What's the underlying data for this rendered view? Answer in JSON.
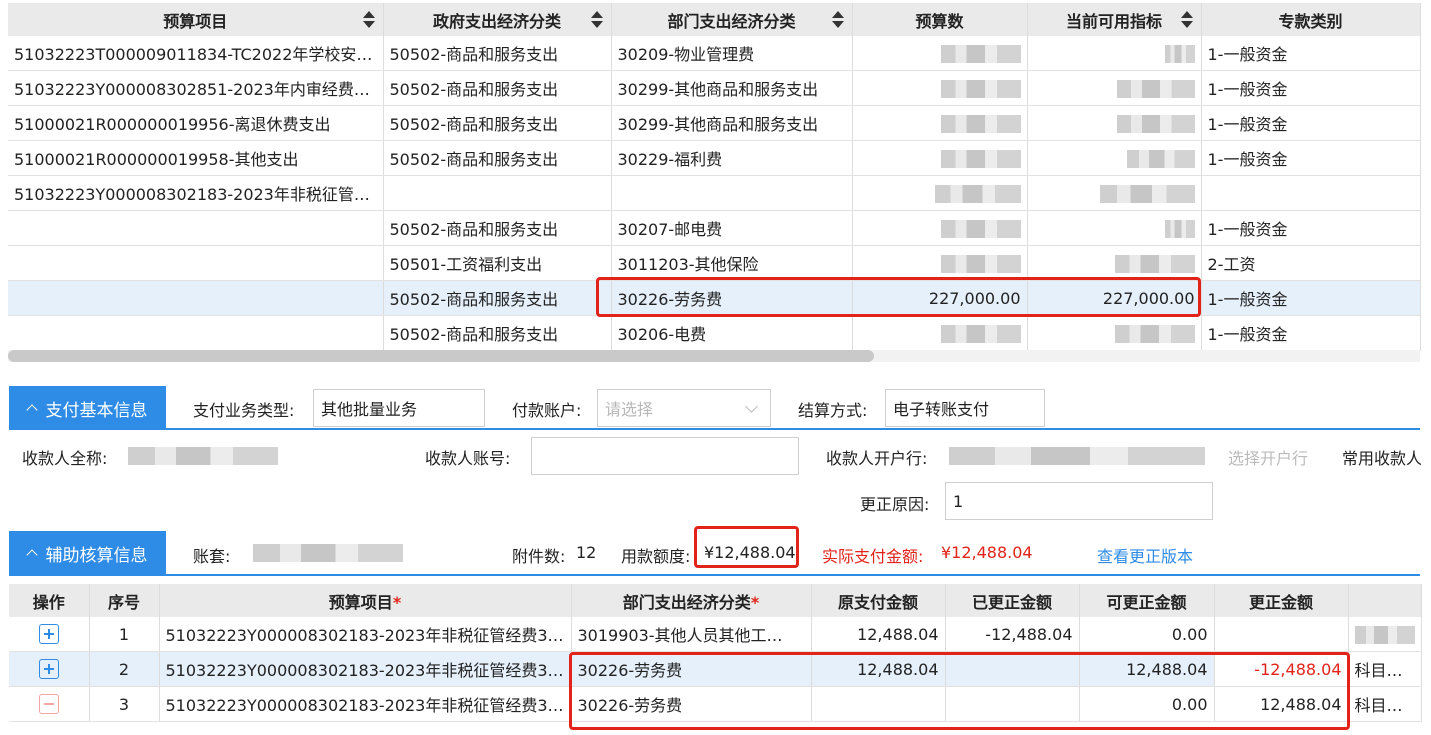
{
  "top_table": {
    "headers": [
      "预算项目",
      "政府支出经济分类",
      "部门支出经济分类",
      "预算数",
      "当前可用指标",
      "专款类别"
    ],
    "rows": [
      {
        "project": "51032223T000009011834-TC2022年学校安…",
        "gov": "50502-商品和服务支出",
        "dept": "30209-物业管理费",
        "budget": "",
        "avail": "",
        "type": "1-一般资金"
      },
      {
        "project": "51032223Y000008302851-2023年内审经费…",
        "gov": "50502-商品和服务支出",
        "dept": "30299-其他商品和服务支出",
        "budget": "",
        "avail": "",
        "type": "1-一般资金"
      },
      {
        "project": "51000021R000000019956-离退休费支出",
        "gov": "50502-商品和服务支出",
        "dept": "30299-其他商品和服务支出",
        "budget": "",
        "avail": "",
        "type": "1-一般资金"
      },
      {
        "project": "51000021R000000019958-其他支出",
        "gov": "50502-商品和服务支出",
        "dept": "30229-福利费",
        "budget": "",
        "avail": "",
        "type": "1-一般资金"
      },
      {
        "project": "51032223Y000008302183-2023年非税征管…",
        "gov": "",
        "dept": "",
        "budget": "",
        "avail": "",
        "type": ""
      },
      {
        "project": "",
        "gov": "50502-商品和服务支出",
        "dept": "30207-邮电费",
        "budget": "",
        "avail": "",
        "type": "1-一般资金"
      },
      {
        "project": "",
        "gov": "50501-工资福利支出",
        "dept": "3011203-其他保险",
        "budget": "",
        "avail": "",
        "type": "2-工资"
      },
      {
        "project": "",
        "gov": "50502-商品和服务支出",
        "dept": "30226-劳务费",
        "budget": "227,000.00",
        "avail": "227,000.00",
        "type": "1-一般资金"
      },
      {
        "project": "",
        "gov": "50502-商品和服务支出",
        "dept": "30206-电费",
        "budget": "",
        "avail": "",
        "type": "1-一般资金"
      }
    ]
  },
  "payment": {
    "tab_label": "支付基本信息",
    "biz_type_label": "支付业务类型:",
    "biz_type_value": "其他批量业务",
    "account_label": "付款账户:",
    "account_placeholder": "请选择",
    "settle_label": "结算方式:",
    "settle_value": "电子转账支付",
    "payee_name_label": "收款人全称:",
    "payee_account_label": "收款人账号:",
    "payee_bank_label": "收款人开户行:",
    "select_bank_label": "选择开户行",
    "common_payee_label": "常用收款人",
    "reason_label": "更正原因:",
    "reason_value": "1"
  },
  "aux": {
    "tab_label": "辅助核算信息",
    "ledger_label": "账套:",
    "attach_label": "附件数:",
    "attach_value": "12",
    "amount_label": "用款额度:",
    "amount_value": "¥12,488.04",
    "actual_label": "实际支付金额:",
    "actual_value": "¥12,488.04",
    "view_version": "查看更正版本"
  },
  "bottom_table": {
    "headers": [
      "操作",
      "序号",
      "预算项目",
      "部门支出经济分类",
      "原支付金额",
      "已更正金额",
      "可更正金额",
      "更正金额",
      ""
    ],
    "rows": [
      {
        "op": "plus",
        "no": "1",
        "project": "51032223Y000008302183-2023年非税征管经费3…",
        "dept": "3019903-其他人员其他工…",
        "orig": "12,488.04",
        "corrected": "-12,488.04",
        "avail": "0.00",
        "amount": "",
        "extra": ""
      },
      {
        "op": "plus",
        "no": "2",
        "project": "51032223Y000008302183-2023年非税征管经费3…",
        "dept": "30226-劳务费",
        "orig": "12,488.04",
        "corrected": "",
        "avail": "12,488.04",
        "amount": "-12,488.04",
        "extra": "科目调剂"
      },
      {
        "op": "minus",
        "no": "3",
        "project": "51032223Y000008302183-2023年非税征管经费3…",
        "dept": "30226-劳务费",
        "orig": "",
        "corrected": "",
        "avail": "0.00",
        "amount": "12,488.04",
        "extra": "科目调剂"
      }
    ]
  },
  "colors": {
    "accent": "#2f8ce6",
    "highlight_box": "#e2231a",
    "selected_row": "#e6f0fb"
  }
}
